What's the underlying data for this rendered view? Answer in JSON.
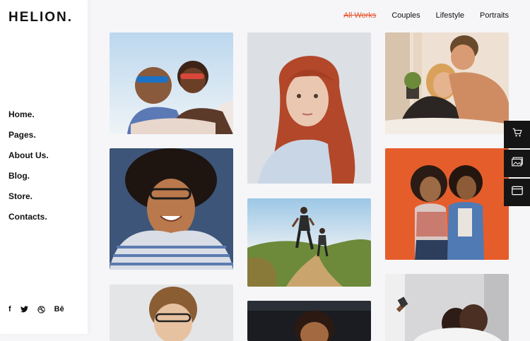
{
  "brand": {
    "logo": "HELION."
  },
  "nav": {
    "items": [
      {
        "label": "Home."
      },
      {
        "label": "Pages."
      },
      {
        "label": "About Us."
      },
      {
        "label": "Blog."
      },
      {
        "label": "Store."
      },
      {
        "label": "Contacts."
      }
    ]
  },
  "social": {
    "items": [
      {
        "label": "f",
        "icon": "facebook-icon"
      },
      {
        "label": "t",
        "icon": "twitter-icon"
      },
      {
        "label": "d",
        "icon": "dribbble-icon"
      },
      {
        "label": "Bē",
        "icon": "behance-icon"
      }
    ]
  },
  "filters": {
    "items": [
      {
        "label": "All Works",
        "active": true
      },
      {
        "label": "Couples",
        "active": false
      },
      {
        "label": "Lifestyle",
        "active": false
      },
      {
        "label": "Portraits",
        "active": false
      }
    ],
    "active_color": "#e8532b"
  },
  "gallery": {
    "items": [
      {
        "name": "photo-laughing-couple"
      },
      {
        "name": "photo-red-haired-woman"
      },
      {
        "name": "photo-couple-on-bed"
      },
      {
        "name": "photo-smiling-woman-glasses"
      },
      {
        "name": "photo-runners-trail"
      },
      {
        "name": "photo-two-women-orange"
      },
      {
        "name": "photo-woman-glasses-bottom"
      },
      {
        "name": "photo-dark-portrait-bottom"
      },
      {
        "name": "photo-selfie-bottom"
      }
    ]
  },
  "tools": {
    "items": [
      {
        "icon": "cart-icon"
      },
      {
        "icon": "gallery-icon"
      },
      {
        "icon": "window-icon"
      }
    ]
  }
}
